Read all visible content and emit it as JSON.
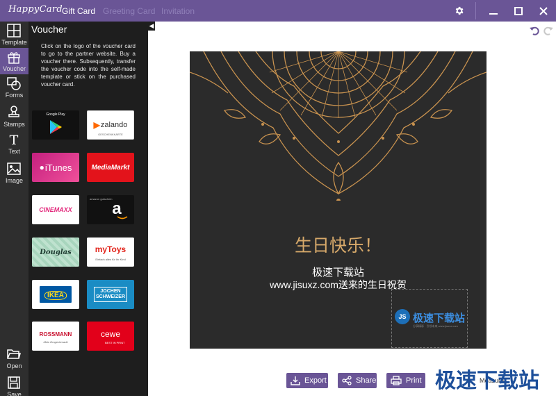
{
  "app": {
    "logo_text": "HappyCard"
  },
  "tabs": [
    {
      "label": "Gift Card",
      "active": true
    },
    {
      "label": "Greeting Card",
      "active": false
    },
    {
      "label": "Invitation",
      "active": false
    }
  ],
  "sidebar": {
    "items": [
      {
        "label": "Template",
        "icon": "template-icon"
      },
      {
        "label": "Voucher",
        "icon": "gift-icon",
        "active": true
      },
      {
        "label": "Forms",
        "icon": "forms-icon"
      },
      {
        "label": "Stamps",
        "icon": "stamp-icon"
      },
      {
        "label": "Text",
        "icon": "text-icon"
      },
      {
        "label": "Image",
        "icon": "image-icon"
      }
    ],
    "bottom_items": [
      {
        "label": "Open",
        "icon": "folder-icon"
      },
      {
        "label": "Save",
        "icon": "save-icon"
      }
    ]
  },
  "panel": {
    "title": "Voucher",
    "description": "Click on the logo of the voucher card to go to the partner website. Buy a voucher there. Subsequently, transfer the voucher code into the self-made template or stick on the purchased voucher card.",
    "vouchers": [
      {
        "name": "Google Play",
        "text": "Google Play",
        "bg": "#111111",
        "fg": "#ffffff"
      },
      {
        "name": "zalando",
        "text": "zalando",
        "sub": "GESCHENKKARTE",
        "bg": "#ffffff",
        "fg": "#333333"
      },
      {
        "name": "iTunes",
        "text": "iTunes",
        "bg": "#d4337c",
        "fg": "#ffffff"
      },
      {
        "name": "MediaMarkt",
        "text": "MediaMarkt",
        "bg": "#e3131b",
        "fg": "#ffffff"
      },
      {
        "name": "Cinemaxx",
        "text": "CINEMAXX",
        "bg": "#ffffff",
        "fg": "#e2267a"
      },
      {
        "name": "amazon",
        "text": "a",
        "sub": "amazon gutschein",
        "bg": "#111111",
        "fg": "#ffffff"
      },
      {
        "name": "Douglas",
        "text": "Douglas",
        "bg": "#a8d5bd",
        "fg": "#1e3a30"
      },
      {
        "name": "myToys",
        "text": "myToys",
        "sub": "Einfach alles für Ihr Kind",
        "bg": "#ffffff",
        "fg": "#e2231a"
      },
      {
        "name": "IKEA",
        "text": "IKEA",
        "bg": "#ffffff",
        "fg": "#ffda1a"
      },
      {
        "name": "Jochen Schweizer",
        "text": "JOCHEN SCHWEIZER",
        "bg": "#1a8cc4",
        "fg": "#ffffff"
      },
      {
        "name": "Rossmann",
        "text": "ROSSMANN",
        "sub": "Mein Drogeriemarkt",
        "bg": "#ffffff",
        "fg": "#c8102e"
      },
      {
        "name": "cewe",
        "text": "cewe",
        "sub": "BEST IN PRINT",
        "bg": "#e2001a",
        "fg": "#ffffff"
      }
    ]
  },
  "card": {
    "title": "生日快乐！",
    "line1": "极速下载站",
    "line2": "www.jisuxz.com送来的生日祝贺",
    "stamp_text": "极速下载站",
    "stamp_subtext": "分享精彩 · 引领未来 www.jisuxz.com"
  },
  "actions": {
    "export": "Export",
    "share": "Share",
    "print": "Print"
  },
  "measure_text": "Measure",
  "watermark": "极速下载站",
  "colors": {
    "accent": "#6a5596",
    "rail_bg": "#2e2e2e",
    "panel_bg": "#1e1e1e",
    "card_bg": "#2b2b2b",
    "gold": "#d7a96a"
  }
}
